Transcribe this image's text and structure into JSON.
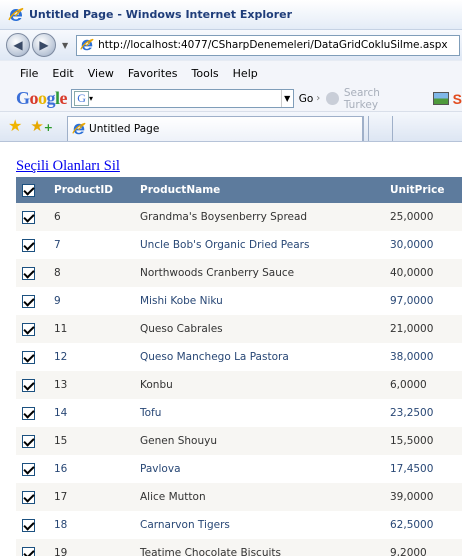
{
  "window": {
    "title": "Untitled Page - Windows Internet Explorer"
  },
  "address_bar": {
    "url": "http://localhost:4077/CSharpDenemeleri/DataGridCokluSilme.aspx"
  },
  "menu": {
    "items": [
      {
        "label": "File"
      },
      {
        "label": "Edit"
      },
      {
        "label": "View"
      },
      {
        "label": "Favorites"
      },
      {
        "label": "Tools"
      },
      {
        "label": "Help"
      }
    ]
  },
  "google_toolbar": {
    "logo": "Google",
    "go_label": "Go",
    "search_turkey_label": "Search Turkey"
  },
  "tab": {
    "title": "Untitled Page"
  },
  "page": {
    "delete_link": "Seçili Olanları Sil",
    "columns": {
      "id": "ProductID",
      "name": "ProductName",
      "price": "UnitPrice"
    },
    "rows": [
      {
        "id": "6",
        "name": "Grandma's Boysenberry Spread",
        "price": "25,0000",
        "checked": true
      },
      {
        "id": "7",
        "name": "Uncle Bob's Organic Dried Pears",
        "price": "30,0000",
        "checked": true
      },
      {
        "id": "8",
        "name": "Northwoods Cranberry Sauce",
        "price": "40,0000",
        "checked": true
      },
      {
        "id": "9",
        "name": "Mishi Kobe Niku",
        "price": "97,0000",
        "checked": true
      },
      {
        "id": "11",
        "name": "Queso Cabrales",
        "price": "21,0000",
        "checked": true
      },
      {
        "id": "12",
        "name": "Queso Manchego La Pastora",
        "price": "38,0000",
        "checked": true
      },
      {
        "id": "13",
        "name": "Konbu",
        "price": "6,0000",
        "checked": true
      },
      {
        "id": "14",
        "name": "Tofu",
        "price": "23,2500",
        "checked": true
      },
      {
        "id": "15",
        "name": "Genen Shouyu",
        "price": "15,5000",
        "checked": true
      },
      {
        "id": "16",
        "name": "Pavlova",
        "price": "17,4500",
        "checked": true
      },
      {
        "id": "17",
        "name": "Alice Mutton",
        "price": "39,0000",
        "checked": true
      },
      {
        "id": "18",
        "name": "Carnarvon Tigers",
        "price": "62,5000",
        "checked": true
      },
      {
        "id": "19",
        "name": "Teatime Chocolate Biscuits",
        "price": "9,2000",
        "checked": true
      }
    ]
  },
  "colors": {
    "header_bg": "#5d7b9d",
    "row_odd_bg": "#f7f6f3",
    "row_odd_text": "#333333",
    "row_even_bg": "#ffffff",
    "row_even_text": "#284775",
    "link": "#0000ee"
  }
}
